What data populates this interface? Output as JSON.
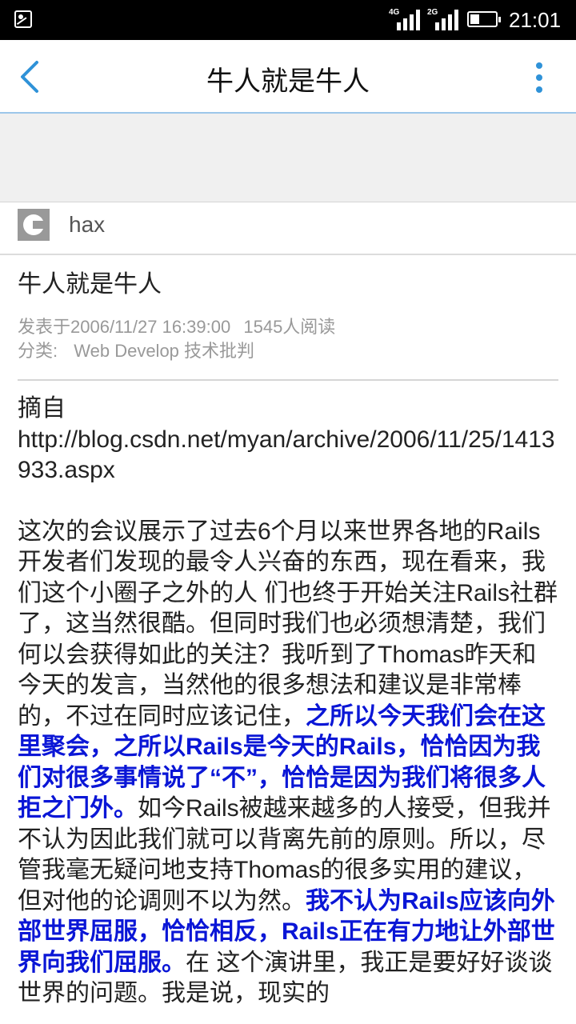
{
  "status": {
    "sig1_label": "4G",
    "sig2_label": "2G",
    "battery_fraction": 0.35,
    "time": "21:01"
  },
  "appbar": {
    "title": "牛人就是牛人",
    "back_icon": "chevron-left-icon",
    "more_icon": "more-vertical-icon",
    "accent": "#2f92d8"
  },
  "author": {
    "name": "hax"
  },
  "article": {
    "title": "牛人就是牛人",
    "published": "发表于2006/11/27 16:39:00",
    "reads": "1545人阅读",
    "category_label": "分类:",
    "category_value": "Web Develop 技术批判",
    "source_prefix": "摘自",
    "source_url": "http://blog.csdn.net/myan/archive/2006/11/25/1413933.aspx",
    "p1": "这次的会议展示了过去6个月以来世界各地的Rails开发者们发现的最令人兴奋的东西，现在看来，我们这个小圈子之外的人 们也终于开始关注Rails社群了，这当然很酷。但同时我们也必须想清楚，我们何以会获得如此的关注？我听到了Thomas昨天和今天的发言，当然他的很多想法和建议是非常棒的，不过在同时应该记住，",
    "hl1": "之所以今天我们会在这里聚会，之所以Rails是今天的Rails，恰恰因为我们对很多事情说了“不”，恰恰是因为我们将很多人拒之门外。",
    "p2": "如今Rails被越来越多的人接受，但我并不认为因此我们就可以背离先前的原则。所以，尽管我毫无疑问地支持Thomas的很多实用的建议，但对他的论调则不以为然。",
    "hl2": "我不认为Rails应该向外部世界屈服，恰恰相反，Rails正在有力地让外部世界向我们屈服。",
    "p3": "在 这个演讲里，我正是要好好谈谈世界的问题。我是说，现实的",
    "highlight_color": "#0a16d6"
  }
}
